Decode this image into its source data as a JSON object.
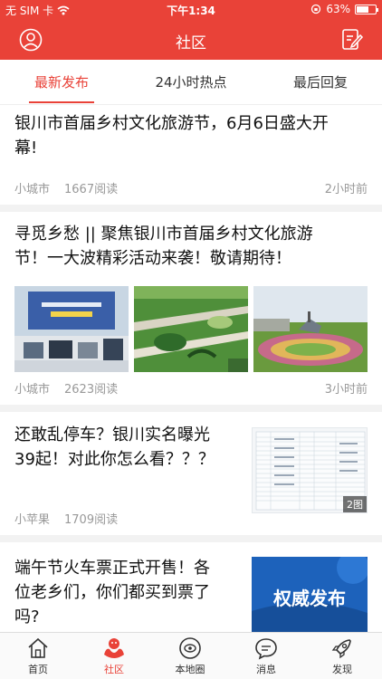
{
  "status": {
    "carrier": "无 SIM 卡",
    "time": "下午1:34",
    "battery": "63%",
    "battery_level": 0.63
  },
  "header": {
    "title": "社区"
  },
  "tabs": [
    {
      "label": "最新发布",
      "active": true
    },
    {
      "label": "24小时热点",
      "active": false
    },
    {
      "label": "最后回复",
      "active": false
    }
  ],
  "posts": [
    {
      "title_line1": "银川市首届乡村文化旅游节，6月6日盛大开",
      "title_line2": "幕!",
      "author": "小城市",
      "reads": "1667阅读",
      "time": "2小时前"
    },
    {
      "title_line1": "寻觅乡愁 || 聚焦银川市首届乡村文化旅游",
      "title_line2": "节！一大波精彩活动来袭！敬请期待！",
      "author": "小城市",
      "reads": "2623阅读",
      "time": "3小时前"
    },
    {
      "title_line1": "还敢乱停车？银川实名曝光",
      "title_line2": "39起！对此你怎么看？？？",
      "author": "小苹果",
      "reads": "1709阅读",
      "image_count": "2图"
    },
    {
      "title_line1": "端午节火车票正式开售！各",
      "title_line2": "位老乡们，你们都买到票了",
      "title_line3": "吗?",
      "image_text": "权威发布"
    }
  ],
  "bottom_tabs": [
    {
      "label": "首页",
      "icon": "home-icon",
      "active": false
    },
    {
      "label": "社区",
      "icon": "community-icon",
      "active": true
    },
    {
      "label": "本地圈",
      "icon": "local-circle-icon",
      "active": false
    },
    {
      "label": "消息",
      "icon": "message-icon",
      "active": false
    },
    {
      "label": "发现",
      "icon": "discover-rocket-icon",
      "active": false
    }
  ],
  "colors": {
    "brand": "#e94238",
    "meta": "#999999",
    "divider": "#f2f2f2"
  }
}
